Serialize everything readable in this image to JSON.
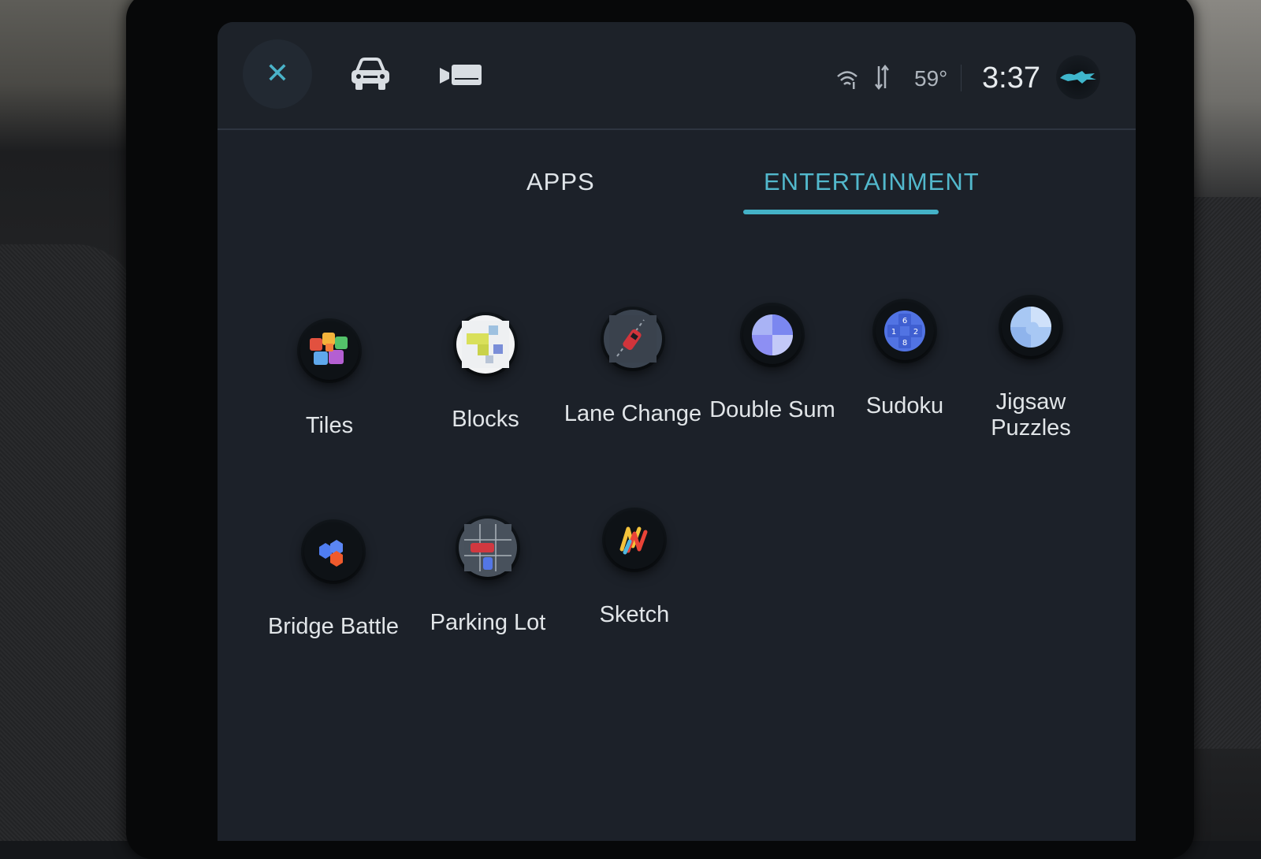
{
  "status_bar": {
    "temperature": "59°",
    "time": "3:37"
  },
  "tabs": [
    {
      "label": "APPS",
      "selected": false
    },
    {
      "label": "ENTERTAINMENT",
      "selected": true
    }
  ],
  "apps": [
    {
      "label": "Tiles",
      "icon": "tiles-icon"
    },
    {
      "label": "Blocks",
      "icon": "blocks-icon"
    },
    {
      "label": "Lane Change",
      "icon": "lane-change-icon"
    },
    {
      "label": "Double Sum",
      "icon": "double-sum-icon"
    },
    {
      "label": "Sudoku",
      "icon": "sudoku-icon"
    },
    {
      "label": "Jigsaw Puzzles",
      "icon": "jigsaw-puzzles-icon"
    },
    {
      "label": "Bridge Battle",
      "icon": "bridge-battle-icon"
    },
    {
      "label": "Parking Lot",
      "icon": "parking-lot-icon"
    },
    {
      "label": "Sketch",
      "icon": "sketch-icon"
    }
  ],
  "sudoku_icon_digits": [
    "6",
    "1",
    "2",
    "8"
  ],
  "colors": {
    "accent": "#44b2c7",
    "screen_background": "#1c2129",
    "text": "#e1e5e8"
  }
}
